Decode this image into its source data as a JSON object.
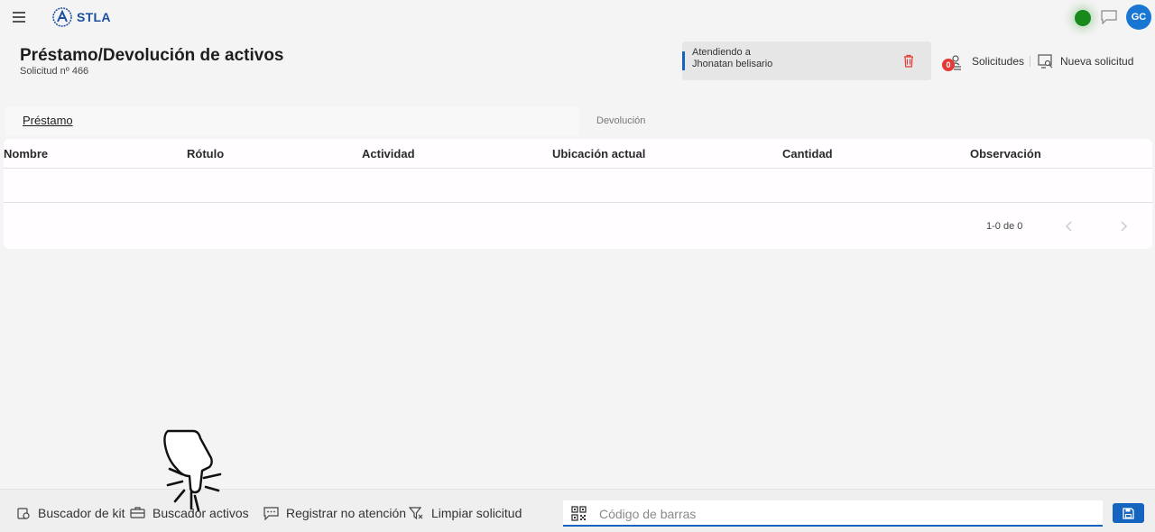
{
  "app": {
    "brand": "STLA",
    "user_initials": "GC",
    "status_color": "#168a1c",
    "accent": "#1565c0"
  },
  "header": {
    "title": "Préstamo/Devolución de activos",
    "subtitle": "Solicitud nº 466",
    "attending_label": "Atendiendo a",
    "attending_name": "Jhonatan belisario",
    "requests_label": "Solicitudes",
    "requests_count": "0",
    "new_request_label": "Nueva solicitud"
  },
  "tabs": [
    {
      "label": "Préstamo",
      "active": true
    },
    {
      "label": "Devolución",
      "active": false
    }
  ],
  "table": {
    "columns": [
      "Nombre",
      "Rótulo",
      "Actividad",
      "Ubicación actual",
      "Cantidad",
      "Observación"
    ],
    "rows": [],
    "pagination": "1-0 de 0"
  },
  "bottom_bar": {
    "kit_search": "Buscador de kit",
    "asset_search": "Buscador activos",
    "register_no_attention": "Registrar no atención",
    "clear_request": "Limpiar solicitud",
    "barcode_placeholder": "Código de barras"
  },
  "icons": [
    "menu-icon",
    "logo-icon",
    "chat-icon",
    "trash-icon",
    "requests-icon",
    "new-request-icon",
    "qr-icon",
    "save-icon",
    "pointer-hand-icon"
  ]
}
